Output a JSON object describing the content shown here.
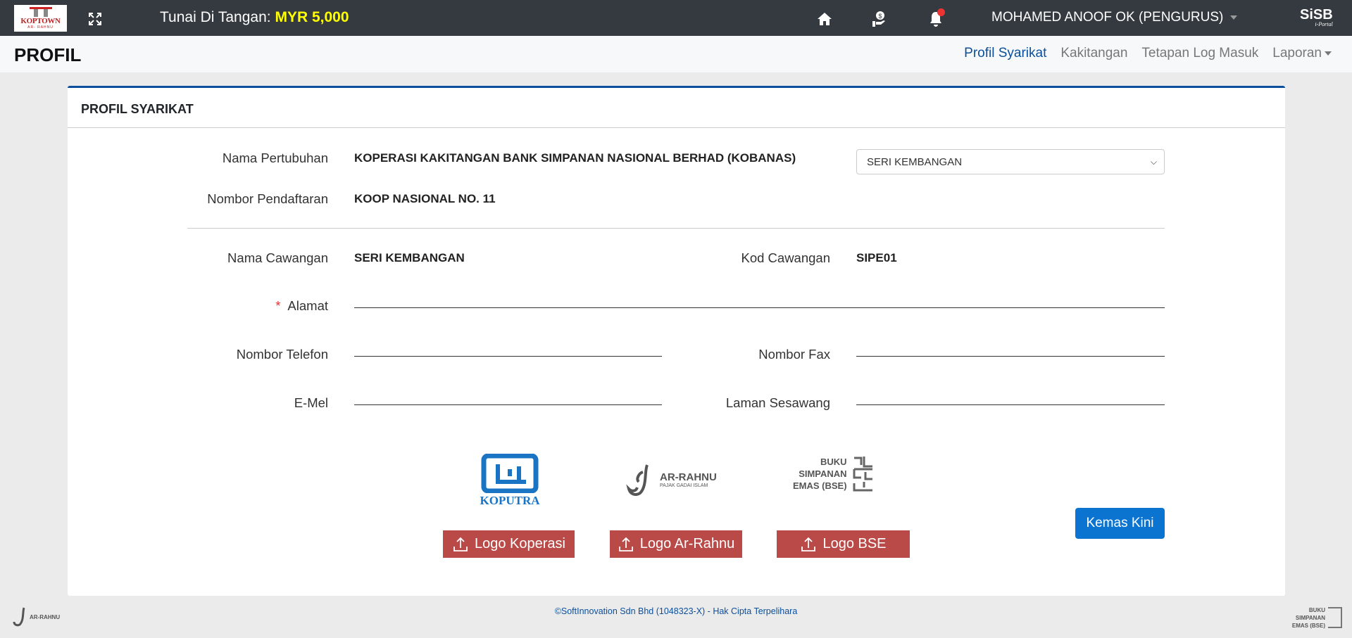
{
  "topbar": {
    "logo_text": "KOPTOWN",
    "logo_sub": "AR- RAHNU",
    "cash_label": "Tunai Di Tangan:",
    "cash_value": "MYR 5,000",
    "user": "MOHAMED ANOOF OK (PENGURUS)",
    "brand": "SiSB",
    "brand_sub": "i-Portal",
    "icons": [
      "expand-icon",
      "home-icon",
      "money-hand-icon",
      "bell-icon"
    ]
  },
  "header": {
    "title": "PROFIL",
    "nav": [
      "Profil Syarikat",
      "Kakitangan",
      "Tetapan Log Masuk",
      "Laporan"
    ],
    "active": "Profil Syarikat"
  },
  "card": {
    "title": "PROFIL SYARIKAT",
    "nama_pertubuhan_label": "Nama Pertubuhan",
    "nama_pertubuhan": "KOPERASI KAKITANGAN BANK SIMPANAN NASIONAL BERHAD (KOBANAS)",
    "branch_select": "SERI KEMBANGAN",
    "nombor_pendaftaran_label": "Nombor Pendaftaran",
    "nombor_pendaftaran": "KOOP NASIONAL NO. 11",
    "nama_cawangan_label": "Nama Cawangan",
    "nama_cawangan": "SERI KEMBANGAN",
    "kod_cawangan_label": "Kod Cawangan",
    "kod_cawangan": "SIPE01",
    "alamat_label": "Alamat",
    "required_mark": "*",
    "telefon_label": "Nombor Telefon",
    "fax_label": "Nombor Fax",
    "emel_label": "E-Mel",
    "laman_label": "Laman Sesawang",
    "logos": {
      "koputra": "KOPUTRA",
      "arrahnu": "AR-RAHNU",
      "arrahnu_sub": "PAJAK GADAI ISLAM",
      "bse": [
        "BUKU",
        "SIMPANAN",
        "EMAS (BSE)"
      ]
    },
    "buttons": {
      "logo_koperasi": "Logo Koperasi",
      "logo_arrahnu": "Logo Ar-Rahnu",
      "logo_bse": "Logo BSE",
      "update": "Kemas Kini"
    }
  },
  "footer": {
    "text": "©SoftInnovation Sdn Bhd (1048323-X) - Hak Cipta Terpelihara",
    "left_logo": "AR-RAHNU",
    "right_logo": "BUKU SIMPANAN EMAS (BSE)"
  }
}
